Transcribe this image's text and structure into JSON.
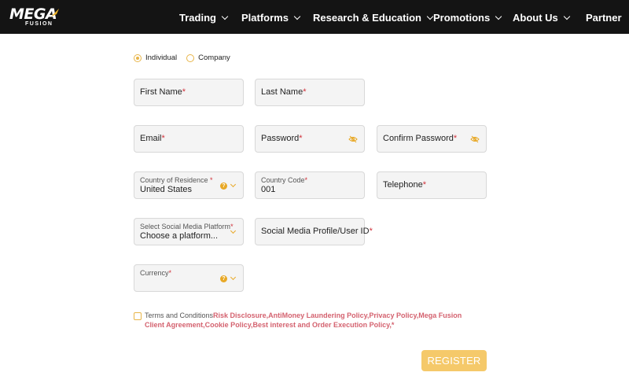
{
  "nav": {
    "logo_main": "MEGA",
    "logo_sub": "FUSION",
    "items": [
      {
        "label": "Trading"
      },
      {
        "label": "Platforms"
      },
      {
        "label": "Research & Education"
      },
      {
        "label": "Promotions"
      },
      {
        "label": "About Us"
      },
      {
        "label": "Partner"
      }
    ]
  },
  "account_type": {
    "options": [
      {
        "label": "Individual",
        "selected": true
      },
      {
        "label": "Company",
        "selected": false
      }
    ]
  },
  "fields": {
    "first_name": {
      "label": "First Name",
      "required": "*"
    },
    "last_name": {
      "label": "Last Name",
      "required": "*"
    },
    "email": {
      "label": "Email",
      "required": "*"
    },
    "password": {
      "label": "Password",
      "required": "*"
    },
    "confirm_password": {
      "label": "Confirm Password",
      "required": "*"
    },
    "country": {
      "label": "Country of Residence",
      "required": " *",
      "value": "United States"
    },
    "country_code": {
      "label": "Country Code",
      "required": "*",
      "value": "001"
    },
    "telephone": {
      "label": "Telephone",
      "required": "*"
    },
    "social_platform": {
      "label": "Select Social Media Platform",
      "required": "*",
      "value": "Choose a platform..."
    },
    "social_id": {
      "label": "Social Media Profile/User ID",
      "required": "*"
    },
    "currency": {
      "label": "Currency",
      "required": "*"
    }
  },
  "terms": {
    "prefix": "Terms and Conditions",
    "links": "Risk Disclosure,AntiMoney Laundering Policy,Privacy Policy,Mega Fusion Client Agreement,Cookie Policy,Best interest and Order Execution Policy,",
    "required": "*"
  },
  "register_label": "REGISTER",
  "colors": {
    "nav_bg": "#141414",
    "accent": "#e8b548",
    "button": "#f5c96a",
    "link": "#d4626f",
    "required": "#d0313a"
  }
}
